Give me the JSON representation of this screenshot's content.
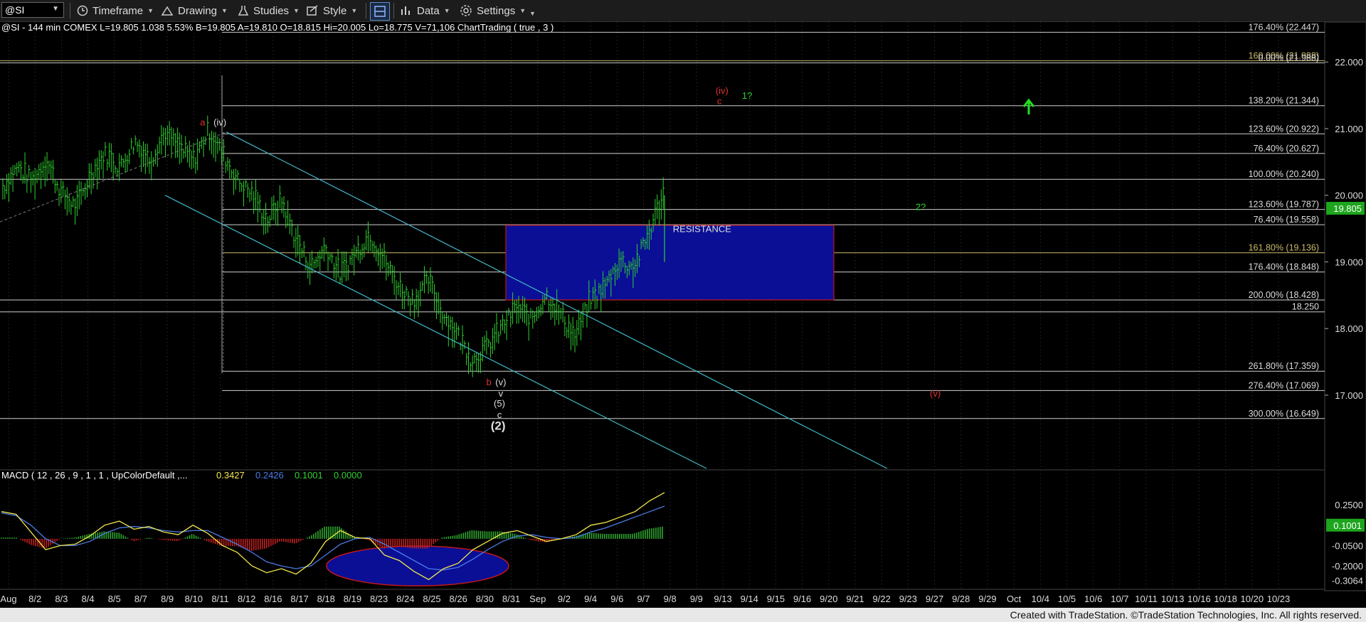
{
  "toolbar": {
    "symbol": "@SI",
    "timeframe": "Timeframe",
    "drawing": "Drawing",
    "studies": "Studies",
    "style": "Style",
    "data": "Data",
    "settings": "Settings"
  },
  "colors": {
    "background": "#000000",
    "bars": "#2fd12f",
    "fib_lines": "#cfcfcf",
    "channel": "#3fb8c8",
    "resistance_fill": "#0a0f96",
    "resistance_border": "#c01818",
    "macd_line": "#f2e84a",
    "signal_line": "#4a7be6",
    "hist_up": "#2fa82f",
    "hist_down": "#c02020"
  },
  "chart_data": {
    "type": "line",
    "header": "@SI - 144 min  COMEX  L=19.805  1.038  5.53%  B=19.805  A=19.810  O=18.815  Hi=20.005  Lo=18.775  V=71,106  ChartTrading ( true , 3 )",
    "ylim": [
      15.9,
      22.6
    ],
    "y_ticks": [
      "22.000",
      "21.000",
      "20.000",
      "19.000",
      "18.000",
      "17.000"
    ],
    "last_price": "19.805",
    "x_labels": [
      "Aug",
      "8/2",
      "8/3",
      "8/4",
      "8/5",
      "8/7",
      "8/9",
      "8/10",
      "8/11",
      "8/12",
      "8/16",
      "8/17",
      "8/18",
      "8/19",
      "8/23",
      "8/24",
      "8/25",
      "8/26",
      "8/30",
      "8/31",
      "Sep",
      "9/2",
      "9/4",
      "9/6",
      "9/7",
      "9/8",
      "9/9",
      "9/13",
      "9/14",
      "9/15",
      "9/16",
      "9/20",
      "9/21",
      "9/22",
      "9/23",
      "9/27",
      "9/28",
      "9/29",
      "Oct",
      "10/4",
      "10/5",
      "10/6",
      "10/7",
      "10/11",
      "10/13",
      "10/16",
      "10/18",
      "10/20",
      "10/23"
    ],
    "fib_levels": [
      {
        "label": "176.40% (22.447)",
        "value": 22.447
      },
      {
        "label": "160.00% (21.988)",
        "value": 22.02
      },
      {
        "label": "0.00% (21.988)",
        "value": 21.988
      },
      {
        "label": "138.20% (21.344)",
        "value": 21.344
      },
      {
        "label": "123.60% (20.922)",
        "value": 20.922
      },
      {
        "label": "76.40% (20.627)",
        "value": 20.627
      },
      {
        "label": "100.00% (20.240)",
        "value": 20.24
      },
      {
        "label": "123.60% (19.787)",
        "value": 19.787
      },
      {
        "label": "76.40% (19.558)",
        "value": 19.558
      },
      {
        "label": "161.80% (19.136)",
        "value": 19.136
      },
      {
        "label": "176.40% (18.848)",
        "value": 18.848
      },
      {
        "label": "200.00% (18.428)",
        "value": 18.428
      },
      {
        "label": "18.250",
        "value": 18.25
      },
      {
        "label": "261.80% (17.359)",
        "value": 17.359
      },
      {
        "label": "276.40% (17.069)",
        "value": 17.069
      },
      {
        "label": "300.00% (16.649)",
        "value": 16.649
      }
    ],
    "price_path": [
      20.1,
      20.4,
      20.2,
      20.5,
      20.0,
      19.8,
      20.3,
      20.6,
      20.4,
      20.8,
      20.5,
      20.9,
      20.7,
      20.5,
      20.95,
      20.6,
      20.2,
      20.0,
      19.6,
      19.9,
      19.3,
      18.9,
      19.2,
      18.8,
      19.1,
      19.4,
      19.0,
      18.6,
      18.4,
      18.7,
      18.2,
      17.9,
      17.5,
      17.7,
      18.0,
      18.3,
      18.1,
      18.5,
      18.2,
      17.85,
      18.4,
      18.6,
      19.0,
      18.9,
      19.4,
      20.0
    ],
    "annotations": [
      {
        "text": "a",
        "color": "#e03030",
        "x": 0.153,
        "y": 21.05
      },
      {
        "text": "(iv)",
        "color": "#dddddd",
        "x": 0.166,
        "y": 21.05
      },
      {
        "text": "(iv)",
        "color": "#e03030",
        "x": 0.545,
        "y": 21.52
      },
      {
        "text": "c",
        "color": "#e03030",
        "x": 0.543,
        "y": 21.37
      },
      {
        "text": "1?",
        "color": "#2fd12f",
        "x": 0.564,
        "y": 21.45
      },
      {
        "text": "2?",
        "color": "#2fd12f",
        "x": 0.695,
        "y": 19.78
      },
      {
        "text": "RESISTANCE",
        "color": "#dddddd",
        "x": 0.53,
        "y": 19.45
      },
      {
        "text": "b",
        "color": "#e03030",
        "x": 0.369,
        "y": 17.15
      },
      {
        "text": "(v)",
        "color": "#dddddd",
        "x": 0.378,
        "y": 17.15
      },
      {
        "text": "v",
        "color": "#dddddd",
        "x": 0.378,
        "y": 16.98
      },
      {
        "text": "(5)",
        "color": "#dddddd",
        "x": 0.377,
        "y": 16.83
      },
      {
        "text": "c",
        "color": "#dddddd",
        "x": 0.377,
        "y": 16.66
      },
      {
        "text": "(2)",
        "color": "#dddddd",
        "x": 0.376,
        "y": 16.48
      },
      {
        "text": "(v)",
        "color": "#e03030",
        "x": 0.706,
        "y": 16.98
      }
    ],
    "resistance_zone": {
      "label": "RESISTANCE",
      "y_range": [
        18.43,
        19.55
      ]
    },
    "macd": {
      "title": "MACD ( 12 , 26 , 9 , 1 , 1 , UpColorDefault ,...",
      "values": [
        "0.3427",
        "0.2426",
        "0.1001",
        "0.0000"
      ],
      "value_colors": [
        "#f2e84a",
        "#4a7be6",
        "#2fd12f",
        "#2fd12f"
      ],
      "y_ticks": [
        "0.2500",
        "-0.0500",
        "-0.2000",
        "-0.3064"
      ],
      "current": "0.1001",
      "ylim": [
        -0.33,
        0.35
      ],
      "macd_line": [
        0.2,
        0.18,
        0.05,
        -0.08,
        -0.05,
        -0.04,
        0.02,
        0.1,
        0.13,
        0.07,
        0.09,
        0.05,
        0.03,
        0.1,
        0.04,
        -0.05,
        -0.1,
        -0.2,
        -0.25,
        -0.22,
        -0.26,
        -0.18,
        -0.02,
        0.06,
        0.01,
        0.0,
        -0.12,
        -0.16,
        -0.24,
        -0.3,
        -0.22,
        -0.18,
        -0.08,
        -0.02,
        0.04,
        0.06,
        0.02,
        -0.02,
        0.0,
        0.03,
        0.1,
        0.12,
        0.16,
        0.2,
        0.28,
        0.34
      ],
      "signal_line": [
        0.19,
        0.17,
        0.1,
        0.0,
        -0.05,
        -0.05,
        -0.02,
        0.04,
        0.08,
        0.09,
        0.08,
        0.06,
        0.05,
        0.06,
        0.06,
        0.01,
        -0.04,
        -0.1,
        -0.17,
        -0.2,
        -0.22,
        -0.2,
        -0.12,
        -0.04,
        0.0,
        0.01,
        -0.04,
        -0.1,
        -0.16,
        -0.22,
        -0.23,
        -0.21,
        -0.15,
        -0.08,
        -0.02,
        0.02,
        0.03,
        0.01,
        0.0,
        0.01,
        0.05,
        0.08,
        0.12,
        0.16,
        0.2,
        0.24
      ]
    }
  },
  "footer": {
    "credit": "Created with TradeStation. ©TradeStation Technologies, Inc. All rights reserved."
  }
}
